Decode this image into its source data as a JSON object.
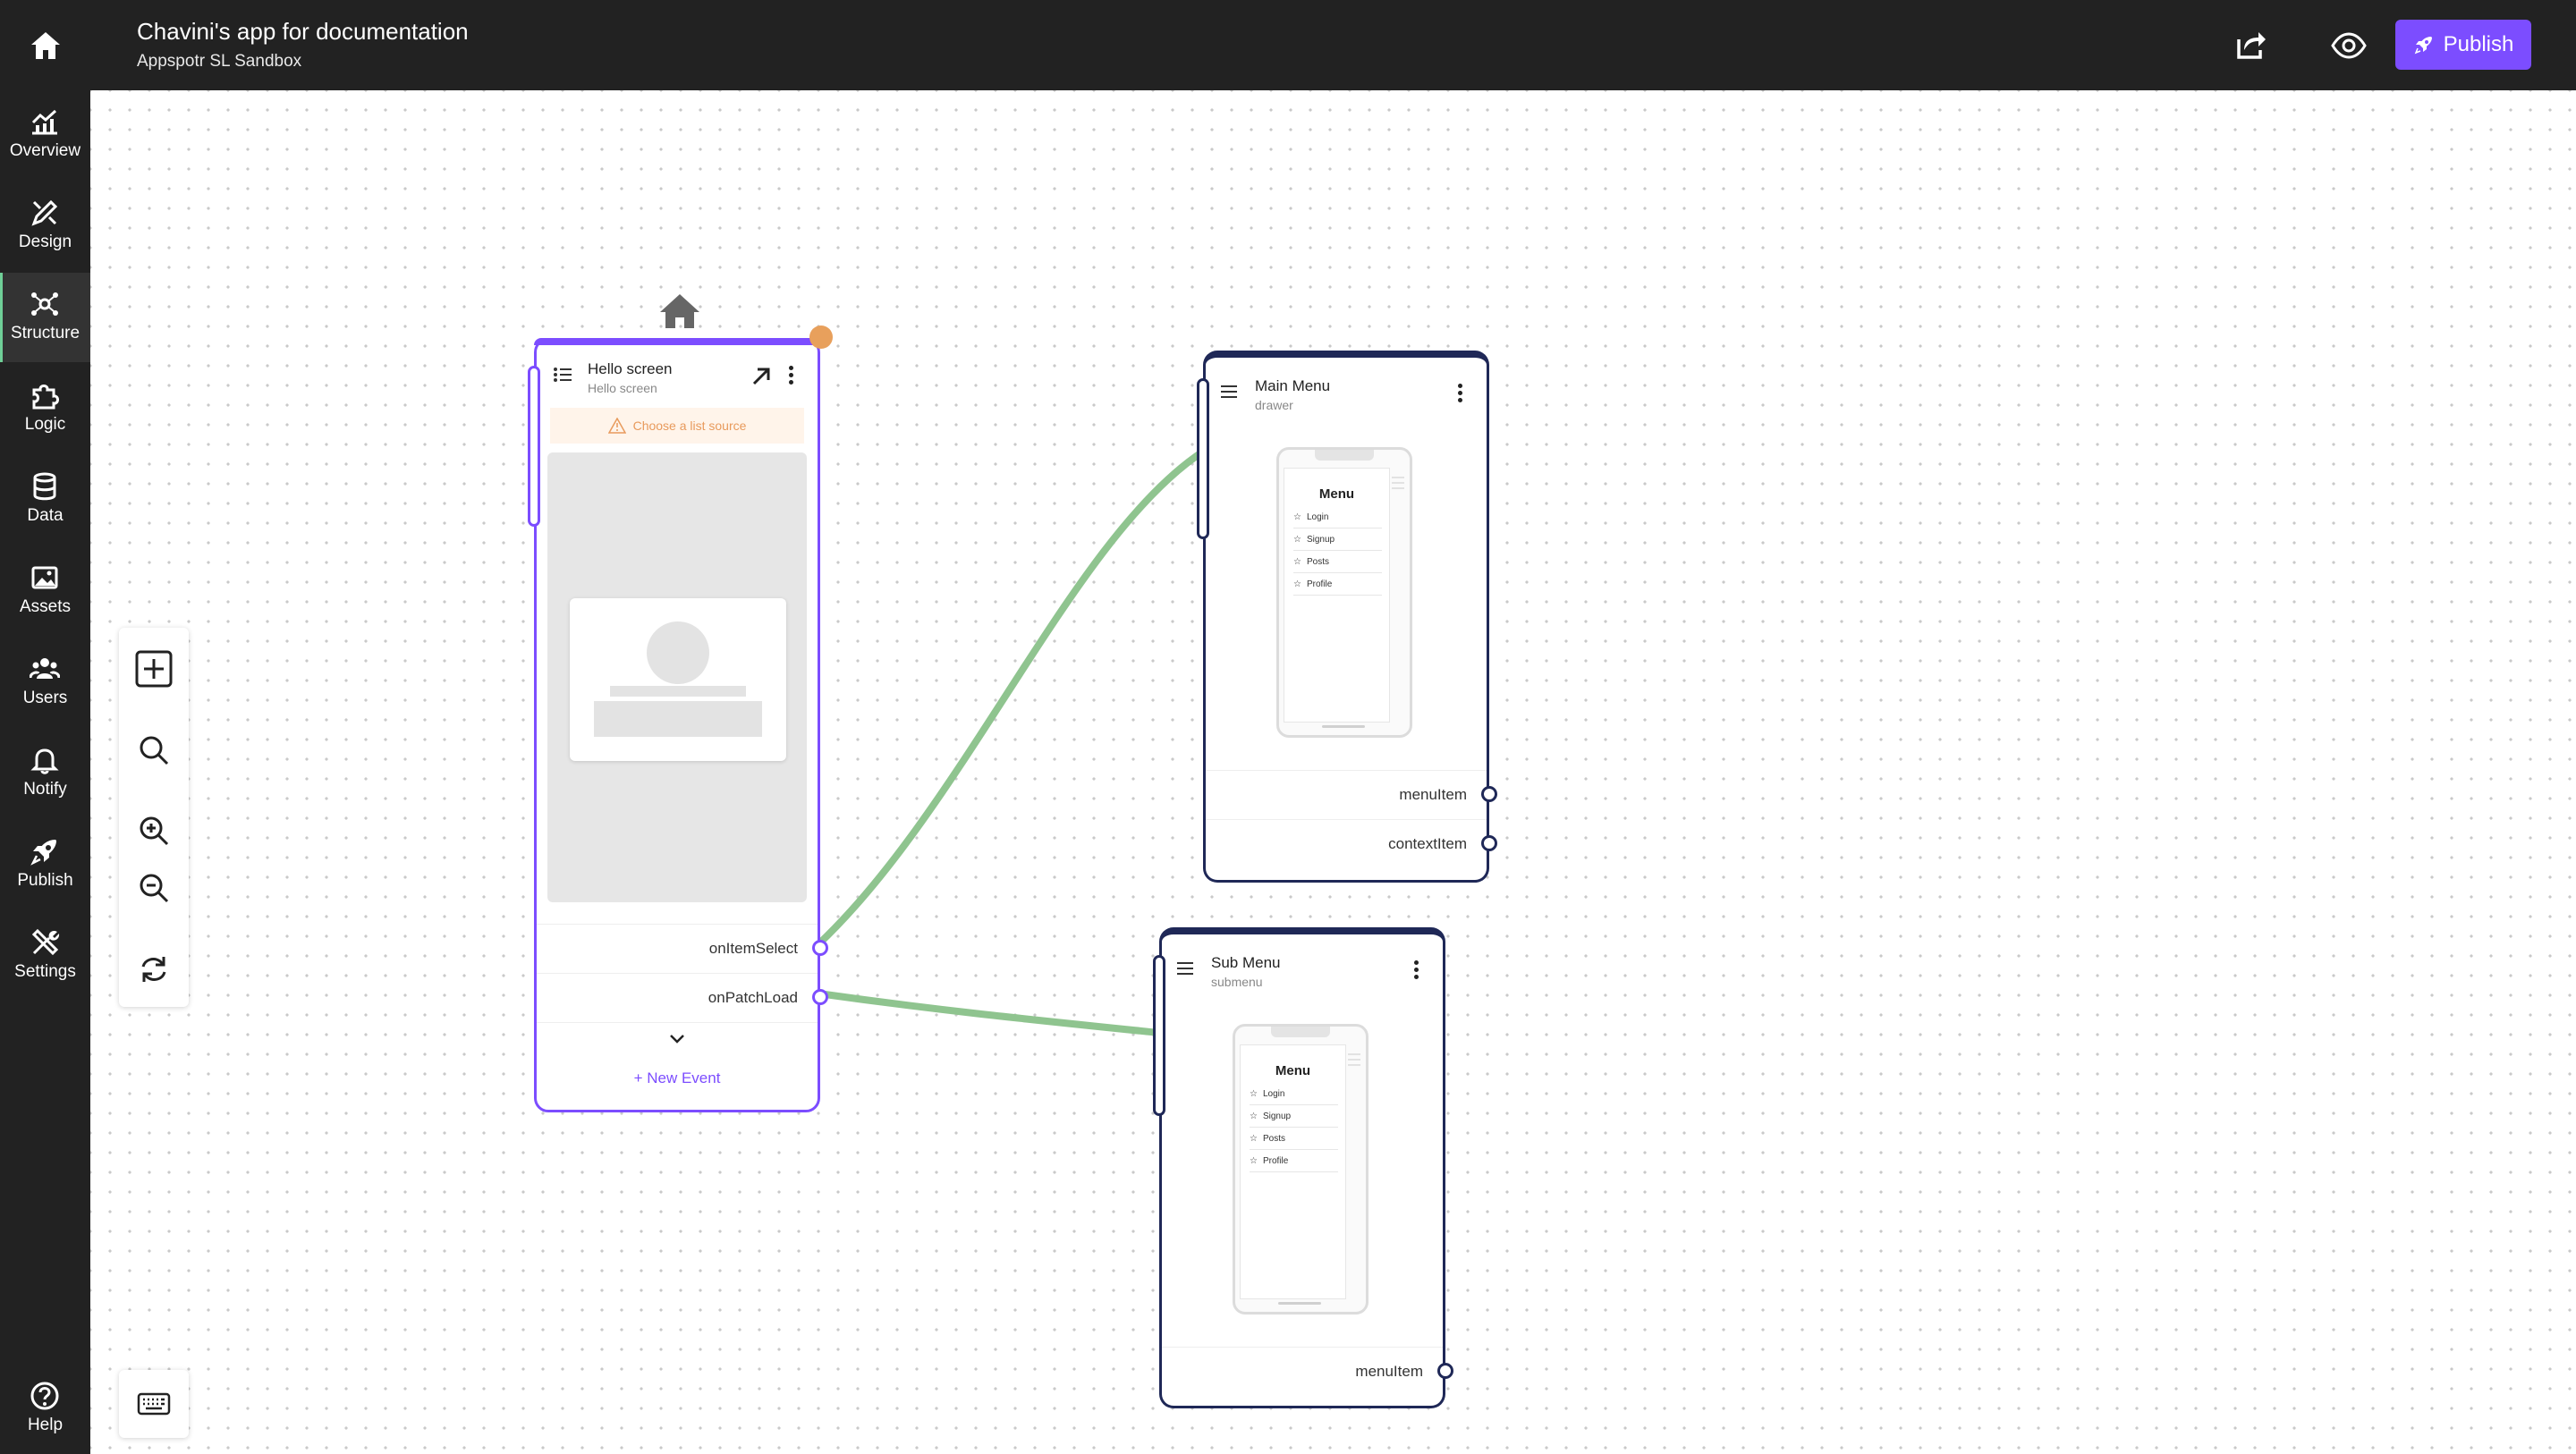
{
  "header": {
    "app_title": "Chavini's app for documentation",
    "app_subtitle": "Appspotr SL Sandbox",
    "publish_label": "Publish"
  },
  "sidebar": {
    "items": [
      {
        "label": "Overview",
        "icon": "chart-icon"
      },
      {
        "label": "Design",
        "icon": "brush-icon"
      },
      {
        "label": "Structure",
        "icon": "structure-icon",
        "active": true
      },
      {
        "label": "Logic",
        "icon": "puzzle-icon"
      },
      {
        "label": "Data",
        "icon": "database-icon"
      },
      {
        "label": "Assets",
        "icon": "image-icon"
      },
      {
        "label": "Users",
        "icon": "users-icon"
      },
      {
        "label": "Notify",
        "icon": "bell-icon"
      },
      {
        "label": "Publish",
        "icon": "rocket-icon"
      },
      {
        "label": "Settings",
        "icon": "tools-icon"
      }
    ],
    "help_label": "Help"
  },
  "nodes": {
    "hello": {
      "title": "Hello screen",
      "subtitle": "Hello screen",
      "warning": "Choose a list source",
      "events": [
        "onItemSelect",
        "onPatchLoad"
      ],
      "new_event": "+ New Event"
    },
    "main_menu": {
      "title": "Main Menu",
      "subtitle": "drawer",
      "preview_title": "Menu",
      "preview_items": [
        "Login",
        "Signup",
        "Posts",
        "Profile"
      ],
      "ports": [
        "menuItem",
        "contextItem"
      ]
    },
    "sub_menu": {
      "title": "Sub Menu",
      "subtitle": "submenu",
      "preview_title": "Menu",
      "preview_items": [
        "Login",
        "Signup",
        "Posts",
        "Profile"
      ],
      "ports": [
        "menuItem"
      ]
    }
  },
  "colors": {
    "accent": "#7c4dff",
    "node_border": "#1f2857",
    "connection": "#8fc48f",
    "warning": "#e89a5c",
    "start_dot": "#e8a05c"
  }
}
